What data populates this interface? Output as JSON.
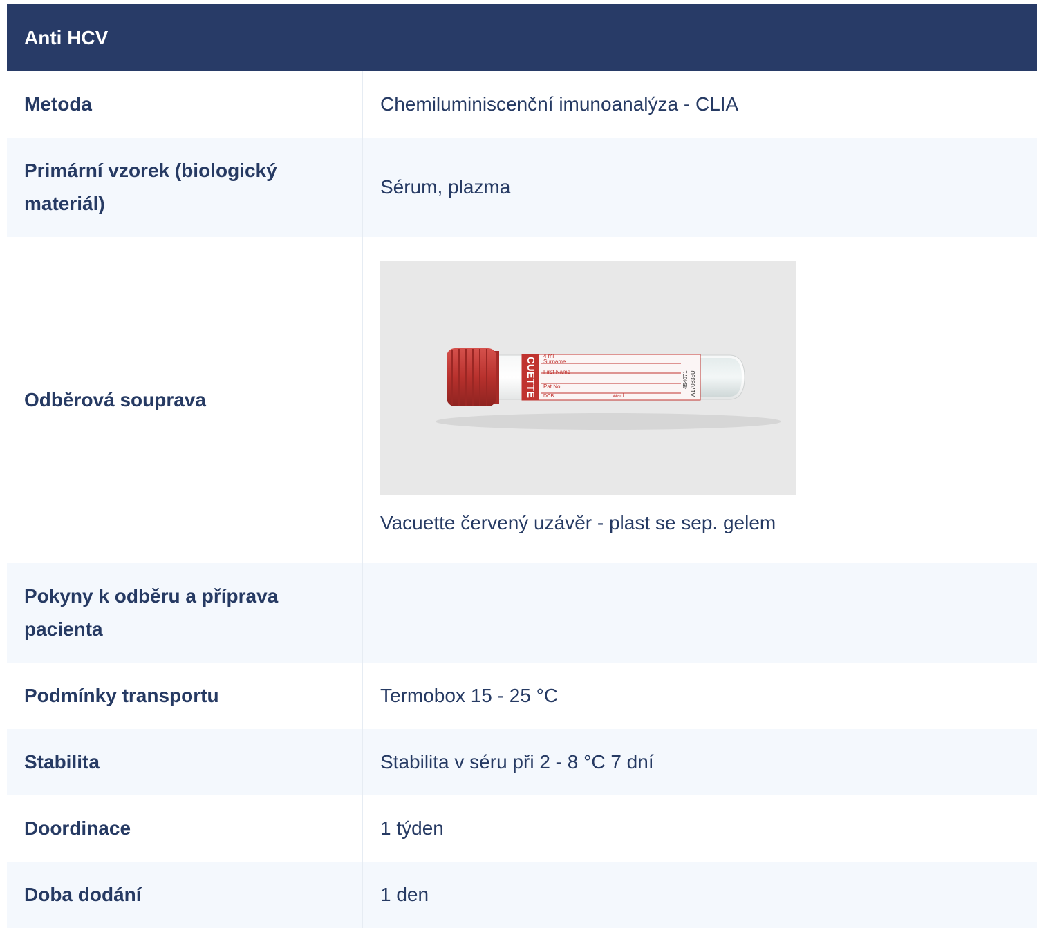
{
  "header": {
    "title": "Anti HCV"
  },
  "rows": [
    {
      "label": "Metoda",
      "value": "Chemiluminiscenční imunoanalýza - CLIA"
    },
    {
      "label": "Primární vzorek (biologický materiál)",
      "value": "Sérum, plazma"
    },
    {
      "label": "Odběrová souprava",
      "value": "Vacuette červený uzávěr - plast se sep. gelem"
    },
    {
      "label": "Pokyny k odběru a příprava pacienta",
      "value": ""
    },
    {
      "label": "Podmínky transportu",
      "value": "Termobox 15 - 25 °C"
    },
    {
      "label": "Stabilita",
      "value": "Stabilita v séru při 2 - 8 °C 7 dní"
    },
    {
      "label": "Doordinace",
      "value": "1 týden"
    },
    {
      "label": "Doba dodání",
      "value": "1 den"
    }
  ],
  "tube": {
    "brand": "CUETTE",
    "volume": "4 ml",
    "fields": [
      "Surname",
      "First Name",
      "Pat.No.",
      "DOB",
      "Ward"
    ],
    "codes": [
      "454071",
      "A170835U"
    ],
    "cap_color": "#c0332f",
    "label_color": "#c0332f"
  }
}
